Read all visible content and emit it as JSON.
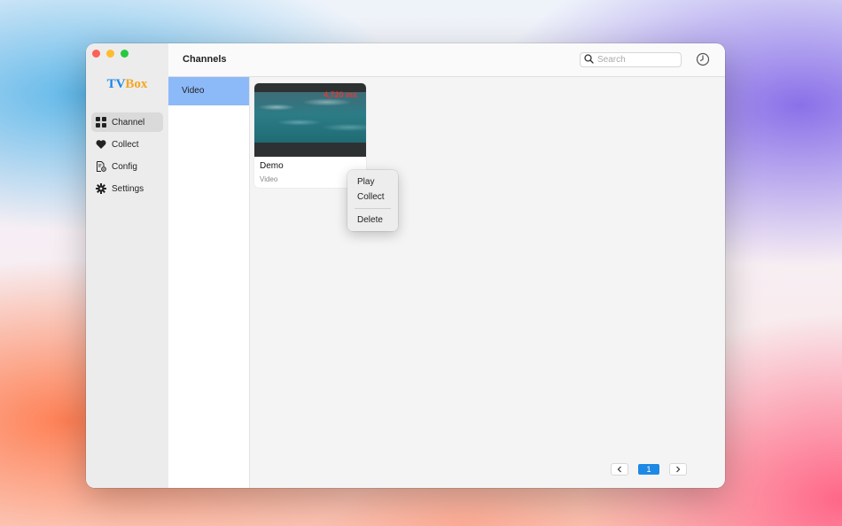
{
  "sidebar": {
    "logo": {
      "part1": "TV",
      "part2": "Box"
    },
    "items": [
      {
        "label": "Channel",
        "icon": "grid-icon",
        "active": true
      },
      {
        "label": "Collect",
        "icon": "heart-icon"
      },
      {
        "label": "Config",
        "icon": "document-gear-icon"
      },
      {
        "label": "Settings",
        "icon": "gear-icon"
      }
    ]
  },
  "header": {
    "title": "Channels",
    "search_placeholder": "Search",
    "history_icon": "clock-icon"
  },
  "categories": [
    {
      "label": "Video",
      "active": true
    }
  ],
  "cards": [
    {
      "title": "Demo",
      "subtitle": "Video",
      "latency": "4,720 ms"
    }
  ],
  "context_menu": {
    "items": [
      "Play",
      "Collect"
    ],
    "danger_item": "Delete"
  },
  "pagination": {
    "current": "1"
  },
  "colors": {
    "accent": "#1e88e5",
    "category_active": "#8cb9f8",
    "latency": "#e53935",
    "logo_tv": "#1e88e5",
    "logo_box": "#f5a623"
  }
}
